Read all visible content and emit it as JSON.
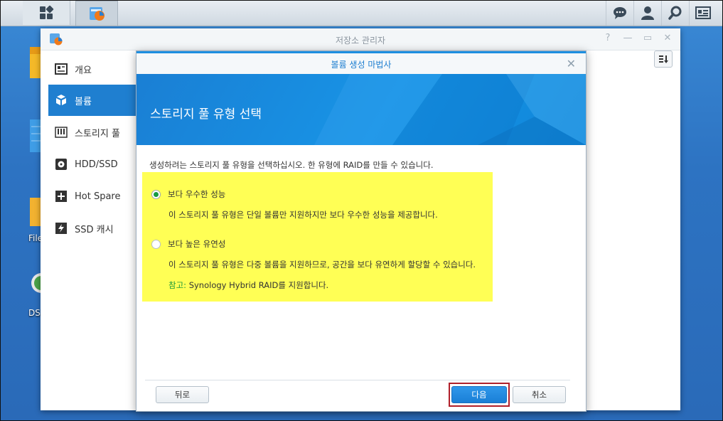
{
  "window": {
    "title": "저장소 관리자"
  },
  "desktop": {
    "icon_labels": [
      "File",
      "DS"
    ]
  },
  "sidebar": {
    "items": [
      {
        "label": "개요",
        "icon": "overview-icon",
        "active": false
      },
      {
        "label": "볼륨",
        "icon": "volume-icon",
        "active": true
      },
      {
        "label": "스토리지 풀",
        "icon": "storage-pool-icon",
        "active": false
      },
      {
        "label": "HDD/SSD",
        "icon": "hdd-icon",
        "active": false
      },
      {
        "label": "Hot Spare",
        "icon": "hot-spare-icon",
        "active": false
      },
      {
        "label": "SSD 캐시",
        "icon": "ssd-cache-icon",
        "active": false
      }
    ]
  },
  "dialog": {
    "title": "볼륨 생성 마법사",
    "heading": "스토리지 풀 유형 선택",
    "instruction": "생성하려는 스토리지 풀 유형을 선택하십시오. 한 유형에 RAID를 만들 수 있습니다.",
    "options": [
      {
        "label": "보다 우수한 성능",
        "description": "이 스토리지 풀 유형은 단일 볼륨만 지원하지만 보다 우수한 성능을 제공합니다.",
        "selected": true
      },
      {
        "label": "보다 높은 유연성",
        "description": "이 스토리지 풀 유형은 다중 볼륨을 지원하므로, 공간을 보다 유연하게 할당할 수 있습니다.",
        "selected": false
      }
    ],
    "note_label": "참고:",
    "note_text": " Synology Hybrid RAID를 지원합니다.",
    "buttons": {
      "back": "뒤로",
      "next": "다음",
      "cancel": "취소"
    }
  },
  "colors": {
    "accent": "#1f7fd0",
    "highlight": "#ffff55",
    "note_green": "#1b9a3a",
    "next_outline": "#b0202a"
  }
}
